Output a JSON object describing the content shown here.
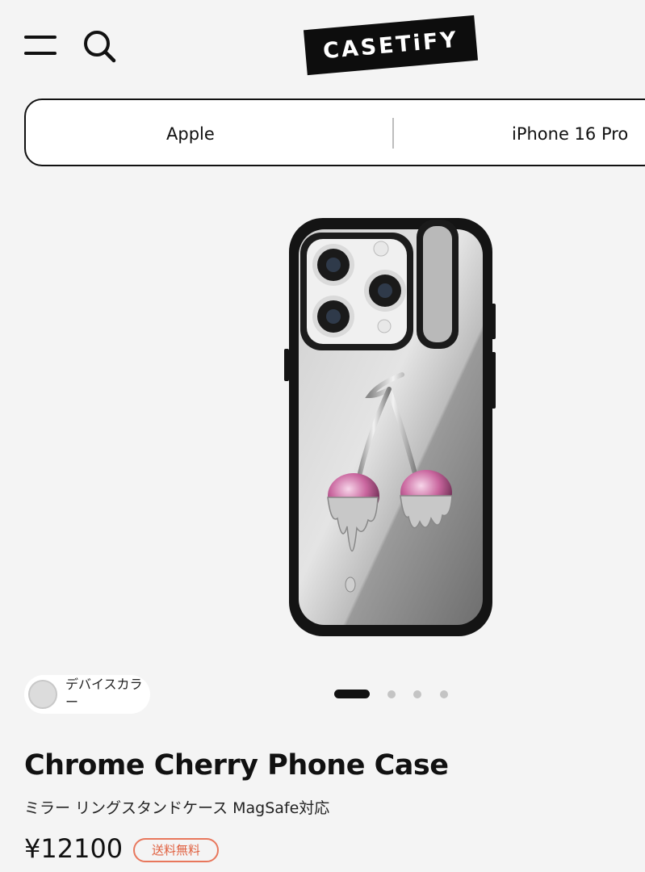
{
  "header": {
    "brand": "CASETiFY",
    "menu_icon": "hamburger-menu-icon",
    "search_icon": "search-icon"
  },
  "device_selector": {
    "brand": "Apple",
    "model": "iPhone 16 Pro"
  },
  "gallery": {
    "image": "chrome-cherry-phone-case",
    "color_option_label": "デバイスカラー",
    "color_swatch": "#dcdcdc",
    "slides_total": 4,
    "active_slide": 1
  },
  "product": {
    "title": "Chrome Cherry Phone Case",
    "subtitle": "ミラー リングスタンドケース MagSafe対応",
    "price": "¥12100",
    "shipping_badge": "送料無料"
  },
  "colors": {
    "background": "#f4f4f4",
    "text": "#111111",
    "badge": "#e8775c"
  }
}
